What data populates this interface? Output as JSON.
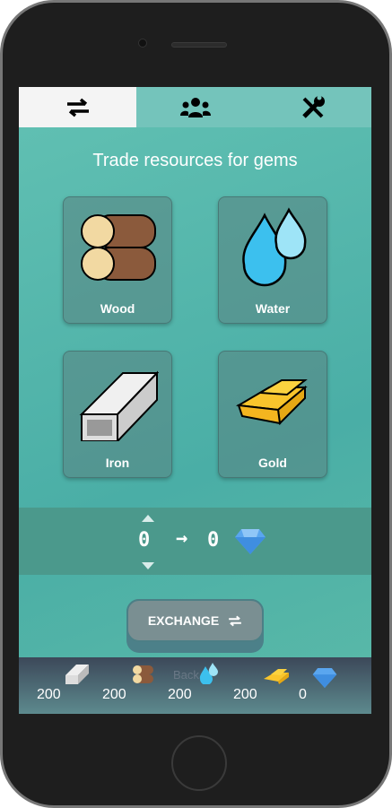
{
  "tabs": [
    {
      "icon": "exchange-icon",
      "active": true
    },
    {
      "icon": "users-icon",
      "active": false
    },
    {
      "icon": "tools-icon",
      "active": false
    }
  ],
  "title": "Trade resources for gems",
  "resources": [
    {
      "label": "Wood"
    },
    {
      "label": "Water"
    },
    {
      "label": "Iron"
    },
    {
      "label": "Gold"
    }
  ],
  "exchange": {
    "amount": "0",
    "result": "0",
    "arrow": "→",
    "button_label": "EXCHANGE"
  },
  "inventory": {
    "iron": "200",
    "wood": "200",
    "water": "200",
    "gold": "200",
    "gems": "0",
    "back_label": "Back"
  },
  "colors": {
    "accent": "#4aaea6",
    "band": "#4b998c",
    "button": "#7a8f92"
  }
}
